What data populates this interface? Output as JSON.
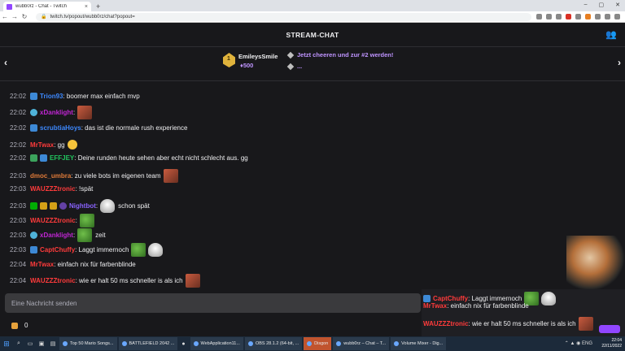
{
  "browser": {
    "tab_title": "wubb0rz - Chat - Twitch",
    "url": "twitch.tv/popout/wubb0rz/chat?popout="
  },
  "header": {
    "title": "STREAM-CHAT"
  },
  "leaderboard": {
    "rank": "1",
    "user": "EmileysSmile",
    "bits": "500",
    "cheer_text": "Jetzt cheeren und zur #2 werden!",
    "dots": "..."
  },
  "messages": [
    {
      "time": "22:02",
      "nick": "Trion93",
      "color": "#3d89ff",
      "text": ": boomer max einfach mvp"
    },
    {
      "time": "22:02",
      "nick": "xDanklight",
      "color": "#c026d3",
      "text": ":"
    },
    {
      "time": "22:02",
      "nick": "scrubtiaHoys",
      "color": "#3d89ff",
      "text": ": das ist die normale rush experience"
    },
    {
      "time": "22:02",
      "nick": "MrTwax",
      "color": "#ff3b3b",
      "text": ": gg"
    },
    {
      "time": "22:02",
      "nick": "EFFJEY",
      "color": "#22c55e",
      "text": ": Deine runden heute sehen aber echt nicht schlecht aus. gg"
    },
    {
      "time": "22:03",
      "nick": "dmoc_umbra",
      "color": "#e07b39",
      "text": ": zu viele bots im eigenen team"
    },
    {
      "time": "22:03",
      "nick": "WAUZZZtronic",
      "color": "#ff3b3b",
      "text": ": !spät"
    },
    {
      "time": "22:03",
      "nick": "Nightbot",
      "color": "#8a63ff",
      "text": ":",
      "after": "schon spät"
    },
    {
      "time": "22:03",
      "nick": "WAUZZZtronic",
      "color": "#ff3b3b",
      "text": ":"
    },
    {
      "time": "22:03",
      "nick": "xDanklight",
      "color": "#c026d3",
      "text": ":",
      "after": "zeit"
    },
    {
      "time": "22:03",
      "nick": "CaptChuffy",
      "color": "#ff3b3b",
      "text": ": Laggt immernoch"
    },
    {
      "time": "22:04",
      "nick": "MrTwax",
      "color": "#ff3b3b",
      "text": ": einfach nix für farbenblinde"
    },
    {
      "time": "22:04",
      "nick": "WAUZZZtronic",
      "color": "#ff3b3b",
      "text": ": wie er halt 50 ms schneller is als ich"
    }
  ],
  "input": {
    "placeholder": "Eine Nachricht senden"
  },
  "points": {
    "value": "0"
  },
  "overlay": [
    {
      "nick": "CaptChuffy",
      "color": "#ff3b3b",
      "text": ": Laggt immernoch"
    },
    {
      "nick": "MrTwax",
      "color": "#ff3b3b",
      "text": ": einfach nix für farbenblinde"
    },
    {
      "nick": "WAUZZZtronic",
      "color": "#ff3b3b",
      "text": ": wie er halt 50 ms schneller is als ich"
    }
  ],
  "taskbar": {
    "apps": [
      "Top 50 Mario Songs...",
      "BATTLEFIELD 2042 ...",
      "WebApplication11...",
      "OBS 28.1.2 (64-bit, ...",
      "Disgon",
      "wubb0rz – Chat – T...",
      "Volume Mixer - Dig..."
    ],
    "lang": "ENG",
    "time": "22:04",
    "date": "22/11/2022"
  }
}
